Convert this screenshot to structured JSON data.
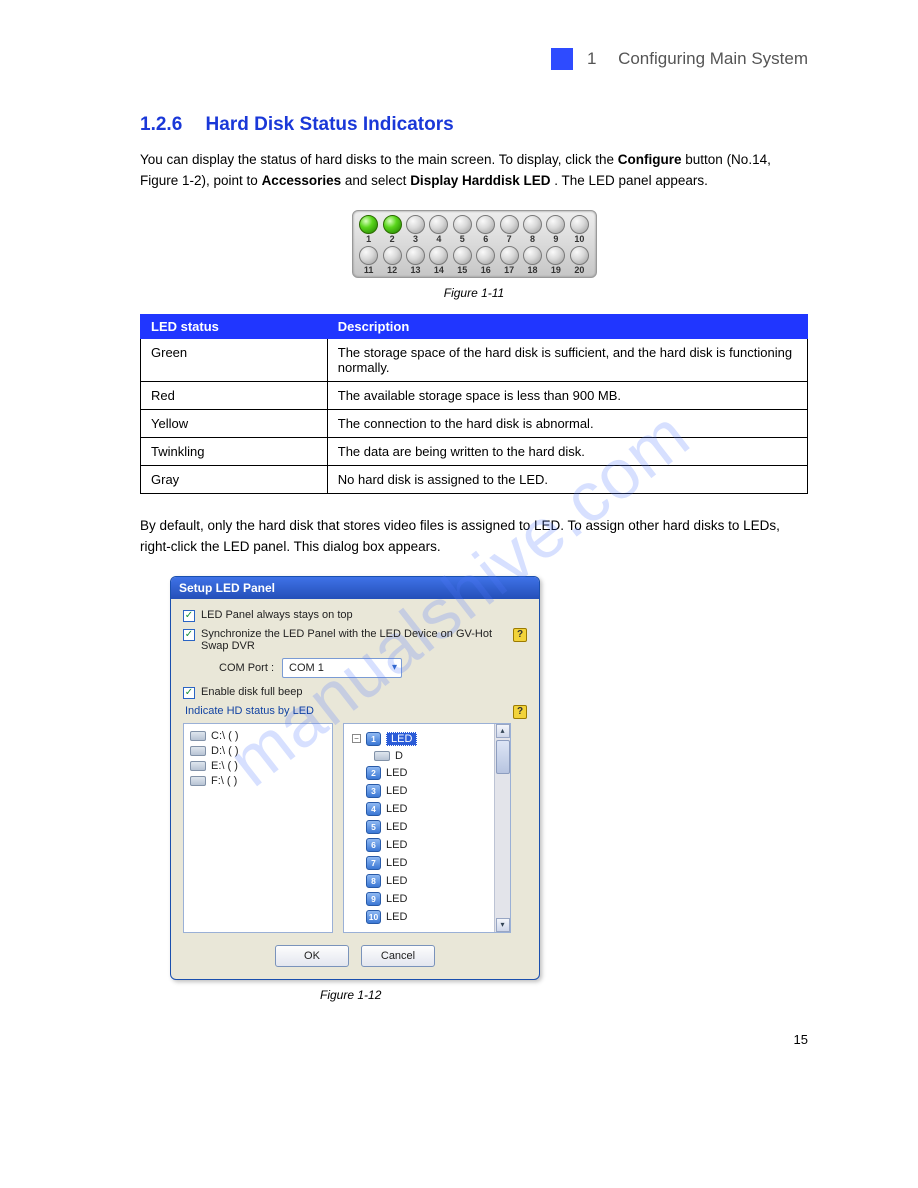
{
  "header": {
    "page": "1",
    "doc_title": "Configuring Main System"
  },
  "section": {
    "number": "1.2.6",
    "title": "Hard Disk Status Indicators"
  },
  "intro_1": "You can display the status of hard disks to the main screen. To display, click the ",
  "intro_bold": "Configure",
  "intro_2": " button (No.14, Figure 1-2), point to ",
  "intro_bold2": "Accessories",
  "intro_3": " and select ",
  "intro_bold3": "Display Harddisk LED",
  "intro_4": ". The LED panel appears.",
  "led_panel": {
    "row1": [
      "1",
      "2",
      "3",
      "4",
      "5",
      "6",
      "7",
      "8",
      "9",
      "10"
    ],
    "row2": [
      "11",
      "12",
      "13",
      "14",
      "15",
      "16",
      "17",
      "18",
      "19",
      "20"
    ]
  },
  "figure1": "Figure 1-11",
  "table": {
    "headers": [
      "LED status",
      "Description"
    ],
    "rows": [
      [
        "Green",
        "The storage space of the hard disk is sufficient, and the hard disk is functioning normally."
      ],
      [
        "Red",
        "The available storage space is less than 900 MB."
      ],
      [
        "Yellow",
        "The connection to the hard disk is abnormal."
      ],
      [
        "Twinkling",
        "The data are being written to the hard disk."
      ],
      [
        "Gray",
        "No hard disk is assigned to the LED."
      ]
    ]
  },
  "para2": "By default, only the hard disk that stores video files is assigned to LED. To assign other hard disks to LEDs, right-click the LED panel. This dialog box appears.",
  "dialog": {
    "title": "Setup LED Panel",
    "chk1": "LED Panel always stays on top",
    "chk2": "Synchronize the LED Panel with the LED Device on GV-Hot Swap DVR",
    "com_label": "COM Port :",
    "com_value": "COM 1",
    "chk3": "Enable disk full beep",
    "hd_label": "Indicate HD status by LED",
    "help": "?",
    "drives": [
      "C:\\ ( )",
      "D:\\ ( )",
      "E:\\ ( )",
      "F:\\ ( )"
    ],
    "tree_first_label": "LED",
    "tree_first_sub": "D",
    "tree_items": [
      "LED",
      "LED",
      "LED",
      "LED",
      "LED",
      "LED",
      "LED",
      "LED",
      "LED"
    ],
    "ok": "OK",
    "cancel": "Cancel"
  },
  "figure2": "Figure 1-12",
  "page_num": "15"
}
